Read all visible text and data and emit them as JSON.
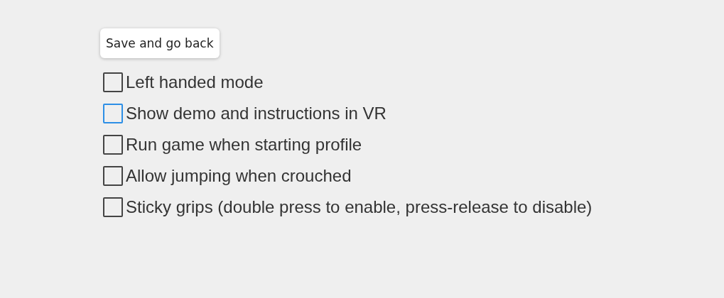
{
  "save_button": {
    "label": "Save and go back"
  },
  "options": [
    {
      "label": "Left handed mode",
      "checked": false,
      "focused": false
    },
    {
      "label": "Show demo and instructions in VR",
      "checked": false,
      "focused": true
    },
    {
      "label": "Run game when starting profile",
      "checked": false,
      "focused": false
    },
    {
      "label": "Allow jumping when crouched",
      "checked": false,
      "focused": false
    },
    {
      "label": "Sticky grips (double press to enable, press-release to disable)",
      "checked": false,
      "focused": false
    }
  ]
}
